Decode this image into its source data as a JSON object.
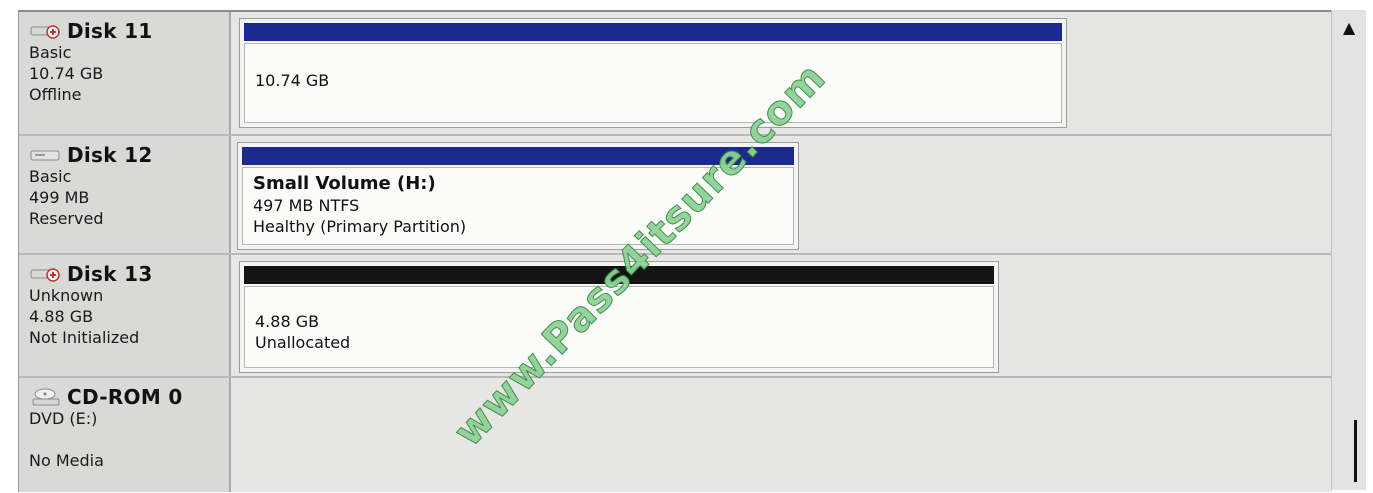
{
  "disks": [
    {
      "title": "Disk 11",
      "icon": "disk-offline-icon",
      "lines": [
        "Basic",
        "10.74 GB",
        "Offline"
      ],
      "volume": {
        "bar_color": "#1b2a8c",
        "name": "",
        "lines": [
          "10.74 GB"
        ]
      }
    },
    {
      "title": "Disk 12",
      "icon": "disk-icon",
      "lines": [
        "Basic",
        "499 MB",
        "Reserved"
      ],
      "volume": {
        "bar_color": "#1b2a8c",
        "name": "Small Volume  (H:)",
        "lines": [
          "497 MB NTFS",
          "Healthy (Primary Partition)"
        ]
      }
    },
    {
      "title": "Disk 13",
      "icon": "disk-offline-icon",
      "lines": [
        "Unknown",
        "4.88 GB",
        "Not Initialized"
      ],
      "volume": {
        "bar_color": "#141414",
        "name": "",
        "lines": [
          "4.88 GB",
          "Unallocated"
        ]
      }
    },
    {
      "title": "CD-ROM 0",
      "icon": "cdrom-icon",
      "lines": [
        "DVD (E:)",
        "",
        "No Media"
      ]
    }
  ],
  "scrollbar": {
    "up_arrow": "▲"
  },
  "watermark": "www.Pass4itsure.com"
}
